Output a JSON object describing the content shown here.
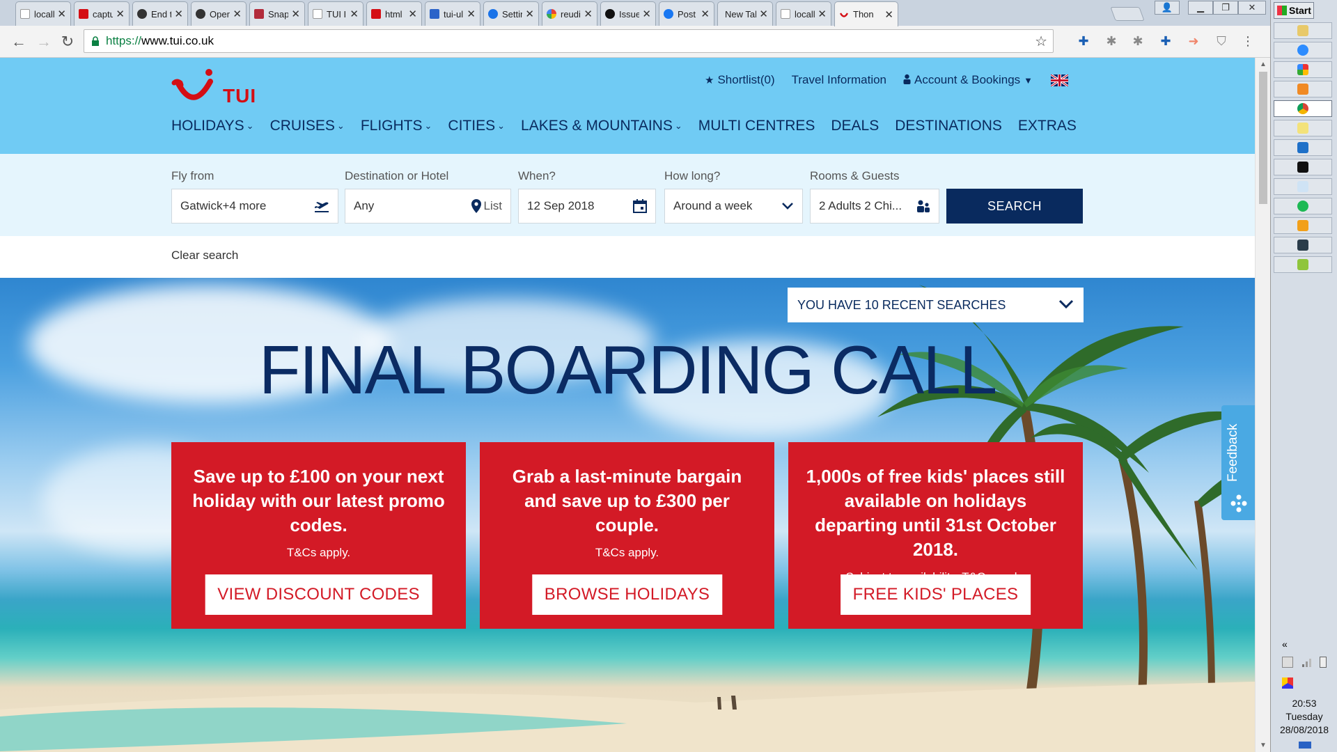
{
  "browser": {
    "tabs": [
      {
        "label": "locall",
        "favicon": "page-icon",
        "color": "#ffffff"
      },
      {
        "label": "captu",
        "favicon": "tui-red-icon",
        "color": "#d40e14"
      },
      {
        "label": "End t",
        "favicon": "cypress-icon",
        "color": "#333333"
      },
      {
        "label": "Oper",
        "favicon": "cypress-icon",
        "color": "#333333"
      },
      {
        "label": "Snap",
        "favicon": "snap-icon",
        "color": "#b22b3b"
      },
      {
        "label": "TUI I",
        "favicon": "page-icon",
        "color": "#ffffff"
      },
      {
        "label": "html",
        "favicon": "tui-red-icon",
        "color": "#d40e14"
      },
      {
        "label": "tui-ul",
        "favicon": "shield-icon",
        "color": "#2b63c9"
      },
      {
        "label": "Settin",
        "favicon": "gear-icon",
        "color": "#1a73e8"
      },
      {
        "label": "reudi",
        "favicon": "google-icon",
        "color": "#4285f4"
      },
      {
        "label": "Issue",
        "favicon": "github-icon",
        "color": "#111111"
      },
      {
        "label": "Post",
        "favicon": "messenger-icon",
        "color": "#1877f2"
      },
      {
        "label": "New Tab",
        "favicon": "",
        "color": "#dde3ea"
      },
      {
        "label": "locall",
        "favicon": "page-icon",
        "color": "#ffffff"
      },
      {
        "label": "Thon",
        "favicon": "tui-smile-icon",
        "color": "#d40e14",
        "active": true
      }
    ],
    "url_scheme": "https://",
    "url_host": "www.tui.co.uk"
  },
  "header": {
    "shortlist": "Shortlist(0)",
    "travel_info": "Travel Information",
    "account": "Account & Bookings",
    "logo_text": "TUI"
  },
  "nav": [
    {
      "label": "HOLIDAYS",
      "caret": true
    },
    {
      "label": "CRUISES",
      "caret": true
    },
    {
      "label": "FLIGHTS",
      "caret": true
    },
    {
      "label": "CITIES",
      "caret": true
    },
    {
      "label": "LAKES & MOUNTAINS",
      "caret": true
    },
    {
      "label": "MULTI CENTRES",
      "caret": false
    },
    {
      "label": "DEALS",
      "caret": false
    },
    {
      "label": "DESTINATIONS",
      "caret": false
    },
    {
      "label": "EXTRAS",
      "caret": false
    }
  ],
  "search": {
    "fly_from_label": "Fly from",
    "fly_from_value": "Gatwick+4 more",
    "destination_label": "Destination or Hotel",
    "destination_value": "Any",
    "destination_list": "List",
    "when_label": "When?",
    "when_value": "12 Sep 2018",
    "how_long_label": "How long?",
    "how_long_value": "Around a week",
    "rooms_label": "Rooms & Guests",
    "rooms_value": "2 Adults 2 Chi...",
    "button": "SEARCH",
    "clear": "Clear search"
  },
  "hero": {
    "recent_searches": "YOU HAVE 10 RECENT SEARCHES",
    "title": "FINAL BOARDING CALL",
    "promos": [
      {
        "headline": "Save up to £100 on your next holiday with our latest promo codes.",
        "terms": "T&Cs apply.",
        "cta": "VIEW DISCOUNT CODES"
      },
      {
        "headline": "Grab a last-minute bargain and save up to £300 per couple.",
        "terms": "T&Cs apply.",
        "cta": "BROWSE HOLIDAYS"
      },
      {
        "headline": "1,000s of free kids' places still available on holidays departing until 31st October 2018.",
        "terms": "Subject to availability. T&Cs apply.",
        "cta": "FREE KIDS' PLACES"
      }
    ],
    "feedback": "Feedback"
  },
  "taskbar": {
    "start": "Start",
    "collapse": "«",
    "time": "20:53",
    "day": "Tuesday",
    "date": "28/08/2018"
  },
  "colors": {
    "header_bg": "#70cbf4",
    "navy": "#092a5e",
    "tui_red": "#d40e14",
    "promo_red": "#d31a26",
    "search_bg": "#e5f5fd"
  }
}
